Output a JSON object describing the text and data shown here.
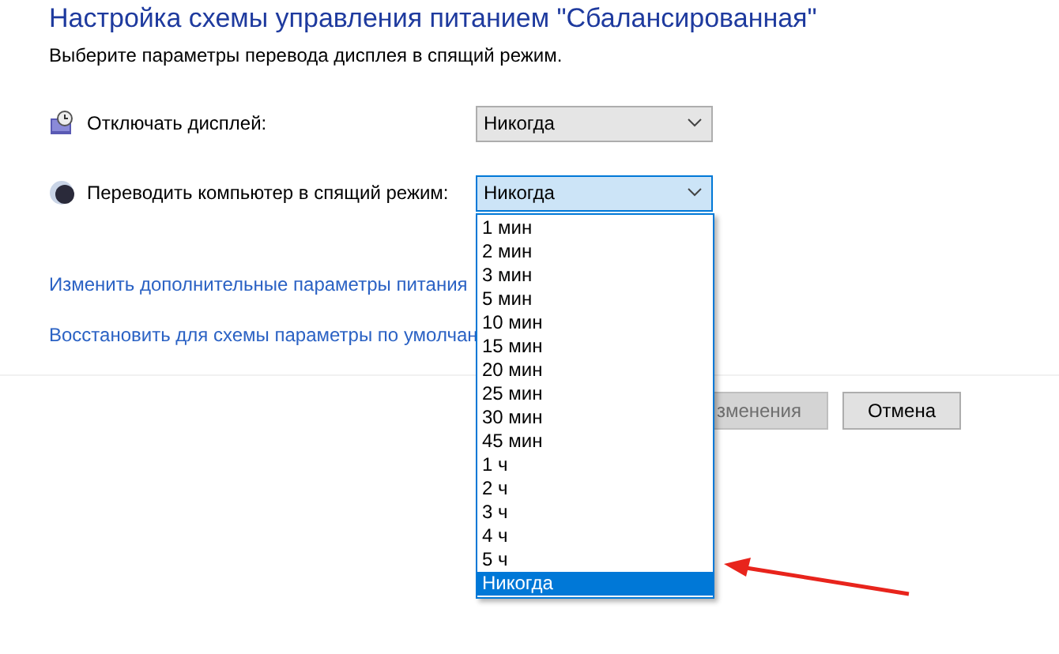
{
  "title": "Настройка схемы управления питанием \"Сбалансированная\"",
  "subtitle": "Выберите параметры перевода дисплея в спящий режим.",
  "settings": [
    {
      "kind": "display",
      "label": "Отключать дисплей:",
      "value": "Никогда",
      "open": false
    },
    {
      "kind": "sleep",
      "label": "Переводить компьютер в спящий режим:",
      "value": "Никогда",
      "open": true
    }
  ],
  "dropdown_options": [
    {
      "label": "1 мин",
      "selected": false
    },
    {
      "label": "2 мин",
      "selected": false
    },
    {
      "label": "3 мин",
      "selected": false
    },
    {
      "label": "5 мин",
      "selected": false
    },
    {
      "label": "10 мин",
      "selected": false
    },
    {
      "label": "15 мин",
      "selected": false
    },
    {
      "label": "20 мин",
      "selected": false
    },
    {
      "label": "25 мин",
      "selected": false
    },
    {
      "label": "30 мин",
      "selected": false
    },
    {
      "label": "45 мин",
      "selected": false
    },
    {
      "label": "1 ч",
      "selected": false
    },
    {
      "label": "2 ч",
      "selected": false
    },
    {
      "label": "3 ч",
      "selected": false
    },
    {
      "label": "4 ч",
      "selected": false
    },
    {
      "label": "5 ч",
      "selected": false
    },
    {
      "label": "Никогда",
      "selected": true
    }
  ],
  "links": [
    "Изменить дополнительные параметры питания",
    "Восстановить для схемы параметры по умолчан"
  ],
  "buttons": [
    {
      "label": "зменения",
      "disabled": true
    },
    {
      "label": "Отмена",
      "disabled": false
    }
  ]
}
